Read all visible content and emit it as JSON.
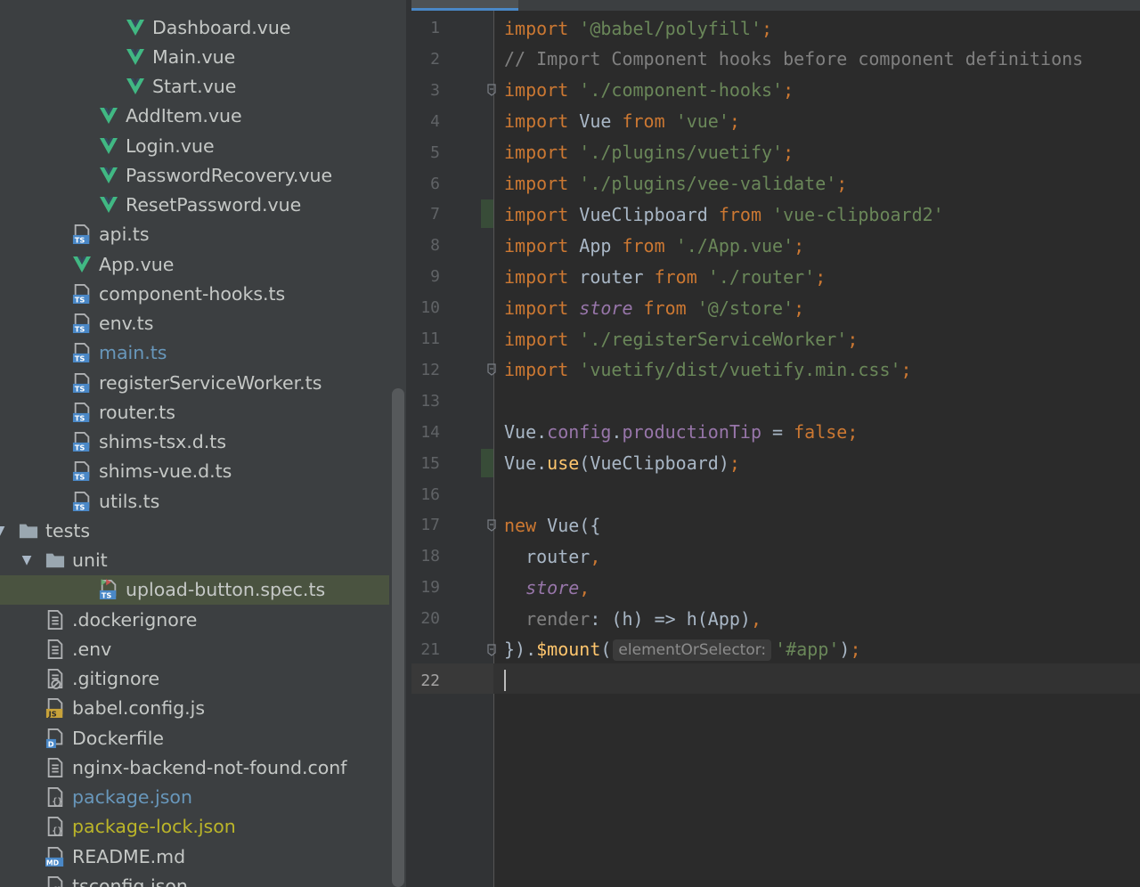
{
  "project_tree": {
    "items": [
      {
        "name": "Dashboard.vue",
        "icon": "vue-icon",
        "indent": 5,
        "color": "normal"
      },
      {
        "name": "Main.vue",
        "icon": "vue-icon",
        "indent": 5,
        "color": "normal"
      },
      {
        "name": "Start.vue",
        "icon": "vue-icon",
        "indent": 5,
        "color": "normal"
      },
      {
        "name": "AddItem.vue",
        "icon": "vue-icon",
        "indent": 4,
        "color": "normal"
      },
      {
        "name": "Login.vue",
        "icon": "vue-icon",
        "indent": 4,
        "color": "normal"
      },
      {
        "name": "PasswordRecovery.vue",
        "icon": "vue-icon",
        "indent": 4,
        "color": "normal"
      },
      {
        "name": "ResetPassword.vue",
        "icon": "vue-icon",
        "indent": 4,
        "color": "normal"
      },
      {
        "name": "api.ts",
        "icon": "ts-file-icon",
        "indent": 3,
        "color": "normal"
      },
      {
        "name": "App.vue",
        "icon": "vue-icon",
        "indent": 3,
        "color": "normal"
      },
      {
        "name": "component-hooks.ts",
        "icon": "ts-file-icon",
        "indent": 3,
        "color": "normal"
      },
      {
        "name": "env.ts",
        "icon": "ts-file-icon",
        "indent": 3,
        "color": "normal"
      },
      {
        "name": "main.ts",
        "icon": "ts-file-icon",
        "indent": 3,
        "color": "modified"
      },
      {
        "name": "registerServiceWorker.ts",
        "icon": "ts-file-icon",
        "indent": 3,
        "color": "normal"
      },
      {
        "name": "router.ts",
        "icon": "ts-file-icon",
        "indent": 3,
        "color": "normal"
      },
      {
        "name": "shims-tsx.d.ts",
        "icon": "ts-file-icon",
        "indent": 3,
        "color": "normal"
      },
      {
        "name": "shims-vue.d.ts",
        "icon": "ts-file-icon",
        "indent": 3,
        "color": "normal"
      },
      {
        "name": "utils.ts",
        "icon": "ts-file-icon",
        "indent": 3,
        "color": "normal"
      },
      {
        "name": "tests",
        "icon": "folder-icon",
        "indent": 1,
        "color": "normal",
        "expanded": true
      },
      {
        "name": "unit",
        "icon": "folder-icon",
        "indent": 2,
        "color": "normal",
        "expanded": true
      },
      {
        "name": "upload-button.spec.ts",
        "icon": "ts-test-icon",
        "indent": 4,
        "color": "normal",
        "selected": true
      },
      {
        "name": ".dockerignore",
        "icon": "text-file-icon",
        "indent": 2,
        "color": "normal"
      },
      {
        "name": ".env",
        "icon": "text-file-icon",
        "indent": 2,
        "color": "normal"
      },
      {
        "name": ".gitignore",
        "icon": "gitignore-icon",
        "indent": 2,
        "color": "normal"
      },
      {
        "name": "babel.config.js",
        "icon": "js-file-icon",
        "indent": 2,
        "color": "normal"
      },
      {
        "name": "Dockerfile",
        "icon": "docker-file-icon",
        "indent": 2,
        "color": "normal"
      },
      {
        "name": "nginx-backend-not-found.conf",
        "icon": "text-file-icon",
        "indent": 2,
        "color": "normal"
      },
      {
        "name": "package.json",
        "icon": "json-file-icon",
        "indent": 2,
        "color": "modified"
      },
      {
        "name": "package-lock.json",
        "icon": "json-file-icon",
        "indent": 2,
        "color": "yellow"
      },
      {
        "name": "README.md",
        "icon": "md-file-icon",
        "indent": 2,
        "color": "normal"
      },
      {
        "name": "tsconfig.json",
        "icon": "json-file-icon",
        "indent": 2,
        "color": "normal"
      }
    ]
  },
  "editor": {
    "current_line": 22,
    "vcs_changed_lines": [
      7,
      15
    ],
    "fold_lines": [
      3,
      12,
      17,
      21
    ],
    "lines": [
      [
        [
          "kw",
          "import "
        ],
        [
          "str",
          "'@babel/polyfill'"
        ],
        [
          "kw",
          ";"
        ]
      ],
      [
        [
          "cmt",
          "// Import Component hooks before component definitions"
        ]
      ],
      [
        [
          "kw",
          "import "
        ],
        [
          "str",
          "'./component-hooks'"
        ],
        [
          "kw",
          ";"
        ]
      ],
      [
        [
          "kw",
          "import "
        ],
        [
          "plain",
          "Vue "
        ],
        [
          "kw",
          "from "
        ],
        [
          "str",
          "'vue'"
        ],
        [
          "kw",
          ";"
        ]
      ],
      [
        [
          "kw",
          "import "
        ],
        [
          "str",
          "'./plugins/vuetify'"
        ],
        [
          "kw",
          ";"
        ]
      ],
      [
        [
          "kw",
          "import "
        ],
        [
          "str",
          "'./plugins/vee-validate'"
        ],
        [
          "kw",
          ";"
        ]
      ],
      [
        [
          "kw",
          "import "
        ],
        [
          "plain",
          "VueClipboard "
        ],
        [
          "kw",
          "from "
        ],
        [
          "str",
          "'vue-clipboard2'"
        ]
      ],
      [
        [
          "kw",
          "import "
        ],
        [
          "plain",
          "App "
        ],
        [
          "kw",
          "from "
        ],
        [
          "str",
          "'./App.vue'"
        ],
        [
          "kw",
          ";"
        ]
      ],
      [
        [
          "kw",
          "import "
        ],
        [
          "plain",
          "router "
        ],
        [
          "kw",
          "from "
        ],
        [
          "str",
          "'./router'"
        ],
        [
          "kw",
          ";"
        ]
      ],
      [
        [
          "kw",
          "import "
        ],
        [
          "purple ital",
          "store "
        ],
        [
          "kw",
          "from "
        ],
        [
          "str",
          "'@/store'"
        ],
        [
          "kw",
          ";"
        ]
      ],
      [
        [
          "kw",
          "import "
        ],
        [
          "str",
          "'./registerServiceWorker'"
        ],
        [
          "kw",
          ";"
        ]
      ],
      [
        [
          "kw",
          "import "
        ],
        [
          "str",
          "'vuetify/dist/vuetify.min.css'"
        ],
        [
          "kw",
          ";"
        ]
      ],
      [],
      [
        [
          "plain",
          "Vue."
        ],
        [
          "purple",
          "config"
        ],
        [
          "plain",
          "."
        ],
        [
          "purple",
          "productionTip"
        ],
        [
          "plain",
          " = "
        ],
        [
          "kw",
          "false;"
        ]
      ],
      [
        [
          "plain",
          "Vue."
        ],
        [
          "fn",
          "use"
        ],
        [
          "plain",
          "(VueClipboard)"
        ],
        [
          "kw",
          ";"
        ]
      ],
      [],
      [
        [
          "kw",
          "new "
        ],
        [
          "plain",
          "Vue({"
        ]
      ],
      [
        [
          "plain",
          "  router"
        ],
        [
          "kw",
          ","
        ]
      ],
      [
        [
          "purple ital",
          "  store"
        ],
        [
          "kw",
          ","
        ]
      ],
      [
        [
          "cmt",
          "  render"
        ],
        [
          "plain",
          ": (h) => h(App)"
        ],
        [
          "kw",
          ","
        ]
      ],
      [
        [
          "plain",
          "})."
        ],
        [
          "fn",
          "$mount"
        ],
        [
          "plain",
          "("
        ],
        [
          "hint",
          "elementOrSelector:"
        ],
        [
          "str",
          "'#app'"
        ],
        [
          "plain",
          ")"
        ],
        [
          "kw",
          ";"
        ]
      ],
      []
    ]
  }
}
